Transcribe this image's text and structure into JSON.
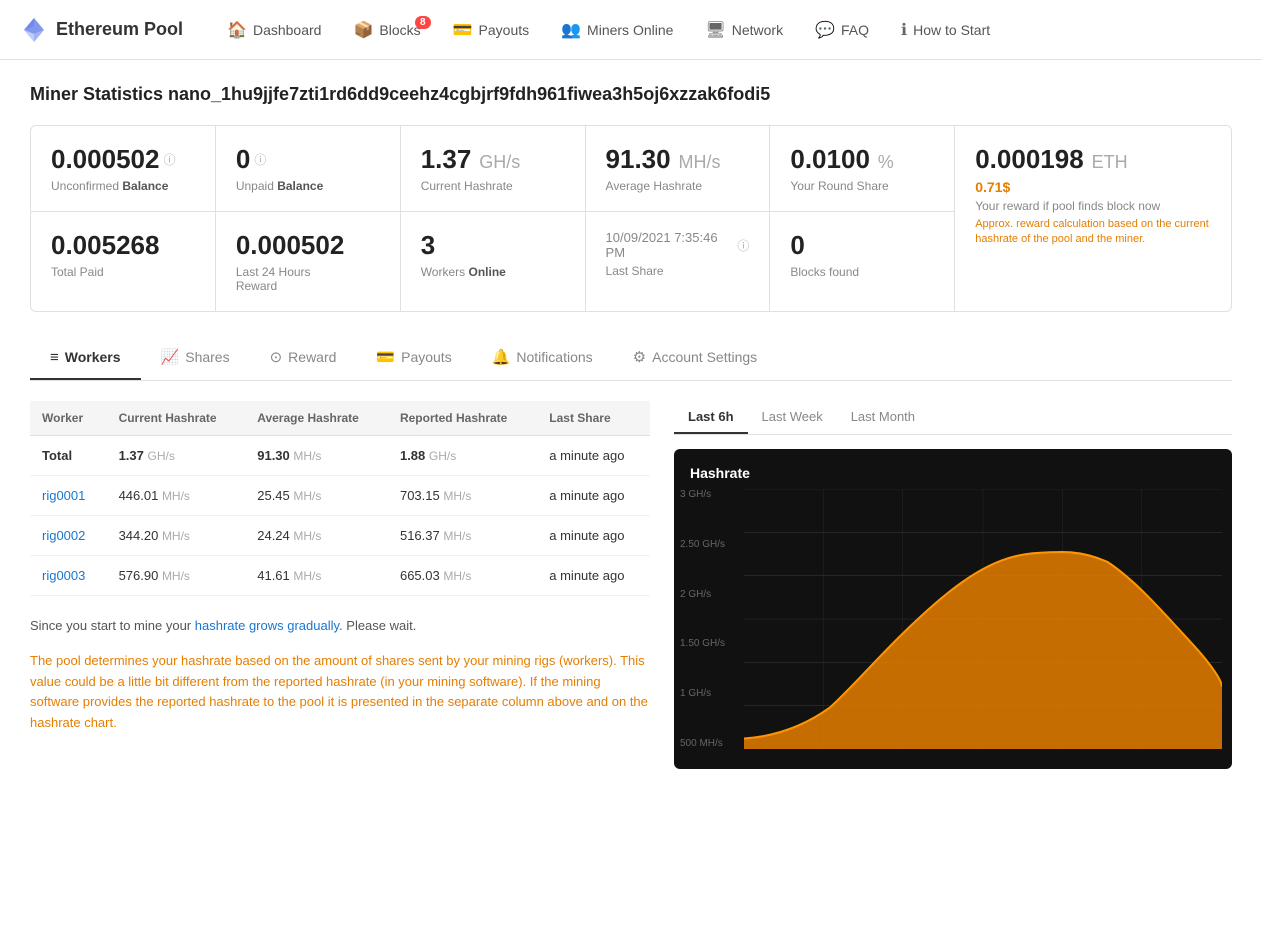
{
  "brand": {
    "name": "Ethereum Pool"
  },
  "nav": {
    "items": [
      {
        "id": "dashboard",
        "label": "Dashboard",
        "icon": "🏠",
        "badge": null
      },
      {
        "id": "blocks",
        "label": "Blocks",
        "icon": "📦",
        "badge": "8"
      },
      {
        "id": "payouts",
        "label": "Payouts",
        "icon": "💳",
        "badge": null
      },
      {
        "id": "miners-online",
        "label": "Miners Online",
        "icon": "👥",
        "badge": null
      },
      {
        "id": "network",
        "label": "Network",
        "icon": "🖥",
        "badge": null
      },
      {
        "id": "faq",
        "label": "FAQ",
        "icon": "💬",
        "badge": null
      },
      {
        "id": "how-to-start",
        "label": "How to Start",
        "icon": "ℹ",
        "badge": null
      }
    ]
  },
  "page": {
    "title": "Miner Statistics nano_1hu9jjfe7zti1rd6dd9ceehz4cgbjrf9fdh961fiwea3h5oj6xzzak6fodi5"
  },
  "stats": {
    "unconfirmed_balance": "0.000502",
    "unconfirmed_label": "Unconfirmed",
    "balance_label": "Balance",
    "unpaid_balance": "0",
    "unpaid_label": "Unpaid",
    "current_hashrate": "1.37",
    "current_hashrate_unit": "GH/s",
    "current_hashrate_label": "Current Hashrate",
    "average_hashrate": "91.30",
    "average_hashrate_unit": "MH/s",
    "average_hashrate_label": "Average Hashrate",
    "round_share": "0.0100",
    "round_share_unit": "%",
    "round_share_label": "Your Round Share",
    "reward_eth": "0.000198",
    "reward_eth_unit": "ETH",
    "reward_usd": "0.71$",
    "reward_label": "Your reward if pool finds block now",
    "reward_note": "Approx. reward calculation based on the current hashrate of the pool and the miner.",
    "total_paid": "0.005268",
    "total_paid_label": "Total Paid",
    "last24h_reward": "0.000502",
    "last24h_label": "Last 24 Hours",
    "last24h_sublabel": "Reward",
    "workers_online": "3",
    "workers_label": "Workers",
    "workers_sublabel": "Online",
    "last_share_time": "10/09/2021 7:35:46 PM",
    "last_share_label": "Last Share",
    "blocks_found": "0",
    "blocks_found_label": "Blocks found"
  },
  "tabs": [
    {
      "id": "workers",
      "label": "Workers",
      "icon": "≡"
    },
    {
      "id": "shares",
      "label": "Shares",
      "icon": "📈"
    },
    {
      "id": "reward",
      "label": "Reward",
      "icon": "⊙"
    },
    {
      "id": "payouts",
      "label": "Payouts",
      "icon": "💳"
    },
    {
      "id": "notifications",
      "label": "Notifications",
      "icon": "🔔"
    },
    {
      "id": "account-settings",
      "label": "Account Settings",
      "icon": "⚙"
    }
  ],
  "table": {
    "headers": [
      "Worker",
      "Current Hashrate",
      "Average Hashrate",
      "Reported Hashrate",
      "Last Share"
    ],
    "total_row": {
      "worker": "Total",
      "current": "1.37",
      "current_unit": "GH/s",
      "average": "91.30",
      "average_unit": "MH/s",
      "reported": "1.88",
      "reported_unit": "GH/s",
      "last_share": "a minute ago"
    },
    "rows": [
      {
        "worker": "rig0001",
        "current": "446.01",
        "current_unit": "MH/s",
        "average": "25.45",
        "average_unit": "MH/s",
        "reported": "703.15",
        "reported_unit": "MH/s",
        "last_share": "a minute ago"
      },
      {
        "worker": "rig0002",
        "current": "344.20",
        "current_unit": "MH/s",
        "average": "24.24",
        "average_unit": "MH/s",
        "reported": "516.37",
        "reported_unit": "MH/s",
        "last_share": "a minute ago"
      },
      {
        "worker": "rig0003",
        "current": "576.90",
        "current_unit": "MH/s",
        "average": "41.61",
        "average_unit": "MH/s",
        "reported": "665.03",
        "reported_unit": "MH/s",
        "last_share": "a minute ago"
      }
    ]
  },
  "info_text": "Since you start to mine your hashrate grows gradually. Please wait.",
  "info_text_orange": "The pool determines your hashrate based on the amount of shares sent by your mining rigs (workers). This value could be a little bit different from the reported hashrate (in your mining software). If the mining software provides the reported hashrate to the pool it is presented in the separate column above and on the hashrate chart.",
  "chart": {
    "title": "Hashrate",
    "tabs": [
      "Last 6h",
      "Last Week",
      "Last Month"
    ],
    "active_tab": "Last 6h",
    "y_labels": [
      "3 GH/s",
      "2.50 GH/s",
      "2 GH/s",
      "1.50 GH/s",
      "1 GH/s",
      "500 MH/s"
    ]
  }
}
